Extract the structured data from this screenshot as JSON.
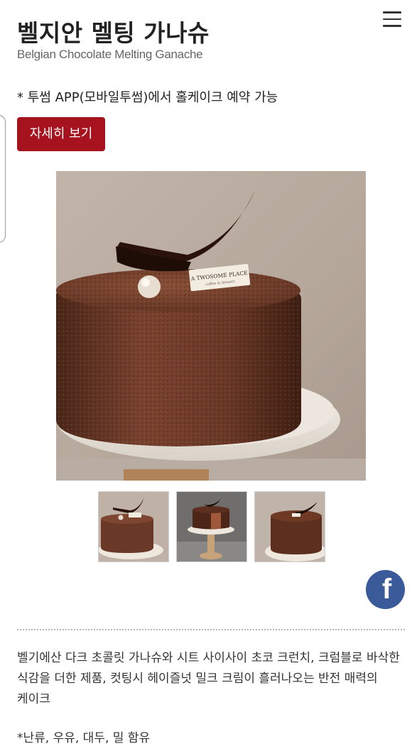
{
  "header": {
    "title": "벨지안 멜팅 가나슈",
    "subtitle": "Belgian Chocolate Melting Ganache",
    "menu_icon": "hamburger-menu-icon"
  },
  "notice": "* 투썸 APP(모바일투썸)에서 홀케이크 예약 가능",
  "detail_button": "자세히 보기",
  "product_image": {
    "plaque_line1": "A TWOSOME PLACE",
    "plaque_line2": "coffee & dessert"
  },
  "thumbnails": [
    {
      "label": "cake-front"
    },
    {
      "label": "cake-slice-on-stand"
    },
    {
      "label": "cake-top"
    }
  ],
  "share": {
    "icon": "facebook-icon",
    "glyph": "f",
    "color": "#3b5a9a"
  },
  "description": "벨기에산 다크 초콜릿 가나슈와 시트 사이사이 초코 크런치, 크럼블로 바삭한 식감을 더한 제품, 컷팅시 헤이즐넛 밀크 크림이 흘러나오는 반전 매력의 케이크",
  "allergens": "*난류, 우유, 대두, 밀 함유",
  "colors": {
    "accent": "#a6131f",
    "facebook": "#3b5a9a"
  }
}
